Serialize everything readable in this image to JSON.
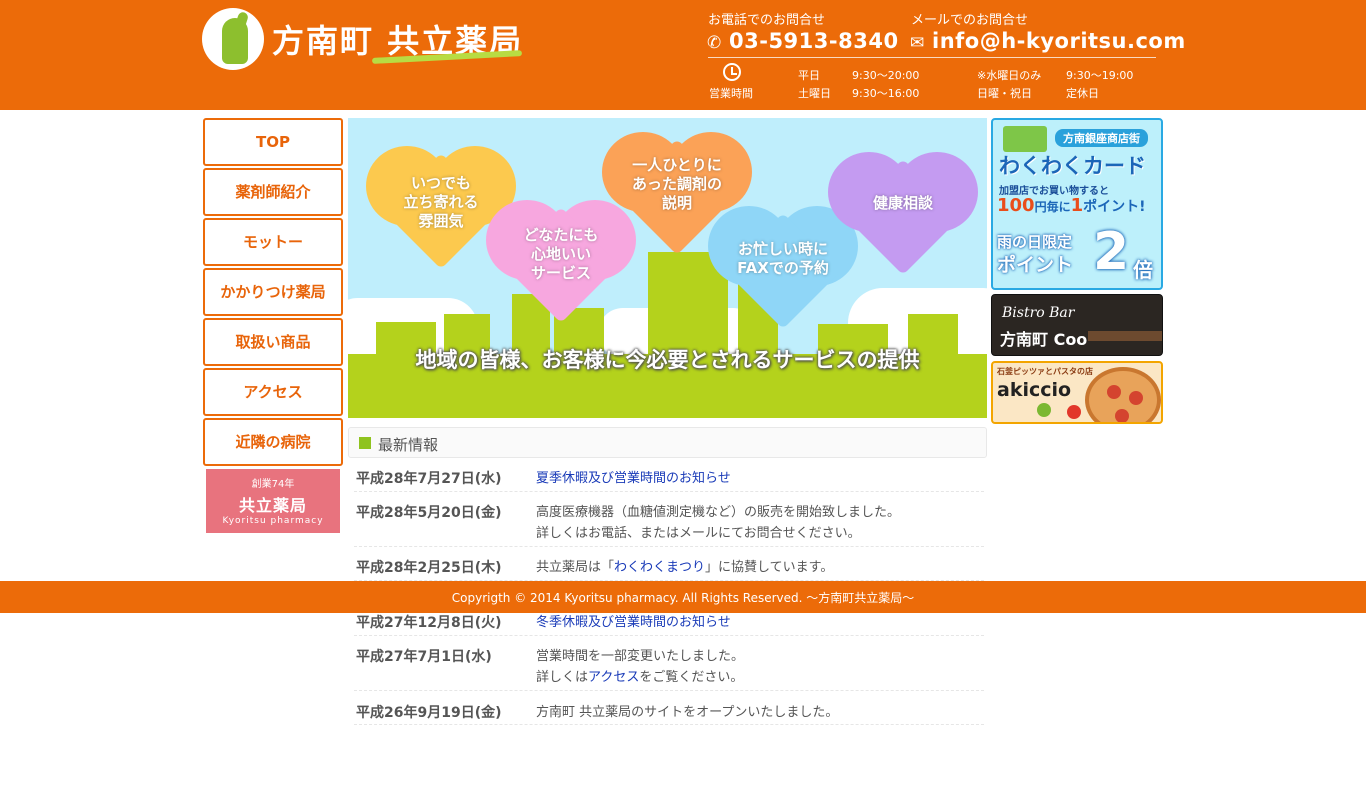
{
  "header": {
    "logo_text": "方南町 共立薬局",
    "phone_label": "お電話でのお問合せ",
    "phone": "03-5913-8340",
    "mail_label": "メールでのお問合せ",
    "email": "info@h-kyoritsu.com",
    "hours_title": "営業時間",
    "hours": [
      {
        "day": "平日",
        "time": "9:30〜20:00",
        "day2": "※水曜日のみ",
        "time2": "9:30〜19:00"
      },
      {
        "day": "土曜日",
        "time": "9:30〜16:00",
        "day2": "日曜・祝日",
        "time2": "定休日"
      }
    ],
    "bg_color": "#ec6b09"
  },
  "nav": {
    "items": [
      "TOP",
      "薬剤師紹介",
      "モットー",
      "かかりつけ薬局",
      "取扱い商品",
      "アクセス",
      "近隣の病院"
    ],
    "badge": {
      "line1": "創業74年",
      "line2": "共立薬局",
      "line3": "Kyoritsu pharmacy"
    }
  },
  "hero": {
    "hearts": [
      "いつでも\n立ち寄れる\n雰囲気",
      "どなたにも\n心地いい\nサービス",
      "一人ひとりに\nあった調剤の\n説明",
      "お忙しい時に\nFAXでの予約",
      "健康相談"
    ],
    "tagline": "地域の皆様、お客様に今必要とされるサービスの提供"
  },
  "news": {
    "title": "最新情報",
    "items": [
      {
        "date": "平成28年7月27日(水)",
        "line1_link": "夏季休暇及び営業時間のお知らせ"
      },
      {
        "date": "平成28年5月20日(金)",
        "line1": "高度医療機器（血糖値測定機など）の販売を開始致しました。",
        "line2": "詳しくはお電話、またはメールにてお問合せください。"
      },
      {
        "date": "平成28年2月25日(木)",
        "pre": "共立薬局は「",
        "link": "わくわくまつり",
        "post": "」に協賛しています。"
      },
      {
        "date": "平成27年12月8日(火)",
        "line1_link": "冬季休暇及び営業時間のお知らせ"
      },
      {
        "date": "平成27年7月1日(水)",
        "line1": "営業時間を一部変更いたしました。",
        "pre": "詳しくは",
        "link": "アクセス",
        "post": "をご覧ください。"
      },
      {
        "date": "平成26年9月19日(金)",
        "line1": "方南町 共立薬局のサイトをオープンいたしました。"
      }
    ]
  },
  "banners": {
    "wakuwaku": {
      "tag": "方南銀座商店街",
      "title": "わくわくカード",
      "sub1": "加盟店でお買い物すると",
      "sub2_a": "100",
      "sub2_b": "円",
      "sub2_c": "毎に",
      "sub2_d": "1",
      "sub2_e": "ポイント!",
      "rain1": "雨の日限定",
      "rain2": "ポイント",
      "two": "2",
      "bai": "倍"
    },
    "bistro": {
      "line1": "Bistro Bar",
      "line2": "方南町 Coo"
    },
    "akiccio": {
      "line1": "石釜ピッツァとパスタの店",
      "line2": "akiccio"
    }
  },
  "footer": {
    "copyright": "Copyrigth © 2014 Kyoritsu pharmacy. All Rights Reserved. 〜方南町共立薬局〜"
  }
}
